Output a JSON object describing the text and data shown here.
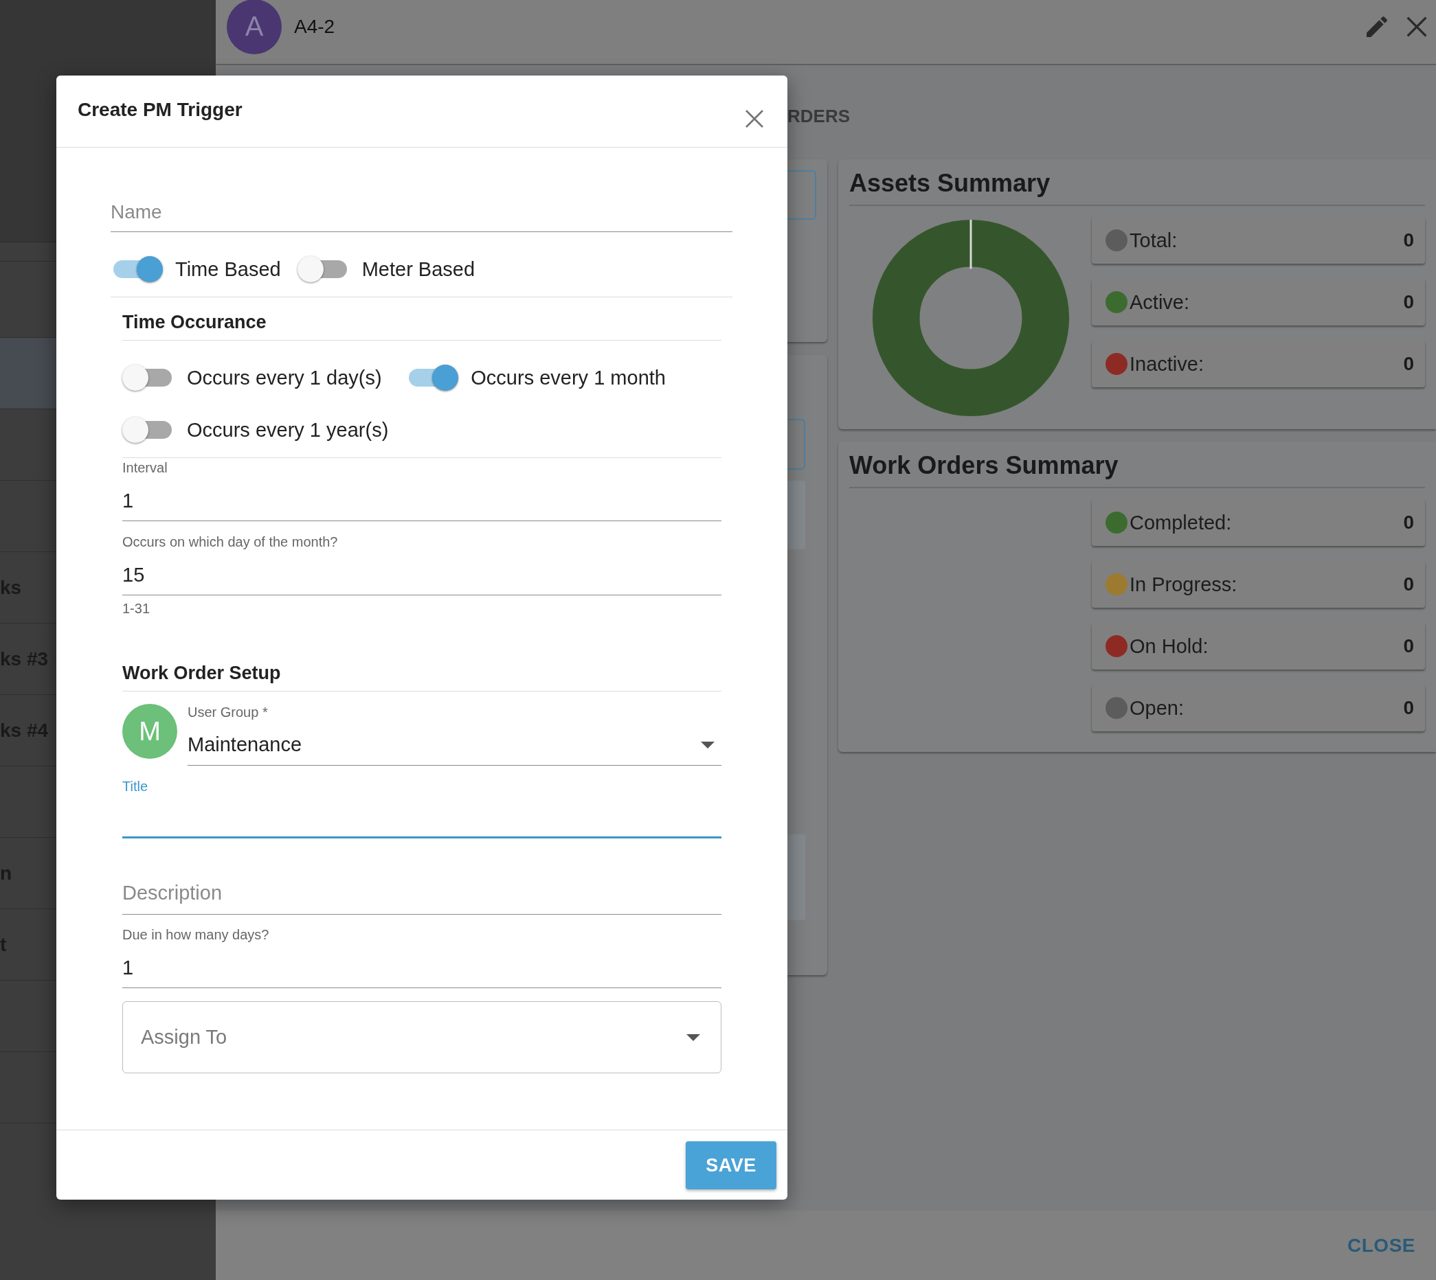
{
  "sidebar": {
    "items": [
      {
        "selected": false
      },
      {
        "selected": true
      },
      {
        "selected": false
      },
      {
        "selected": false
      },
      {
        "label": "ks",
        "selected": false
      },
      {
        "label": "ks #3",
        "selected": false
      },
      {
        "label": "ks #4",
        "selected": false
      },
      {
        "selected": false
      },
      {
        "label": "n",
        "selected": false
      },
      {
        "label": "t",
        "selected": false
      },
      {
        "selected": false
      },
      {
        "selected": false
      },
      {
        "selected": false
      }
    ]
  },
  "record": {
    "avatar": "A",
    "title": "A4-2"
  },
  "tabs": [
    "RDERS"
  ],
  "assets_summary": {
    "title": "Assets Summary",
    "legend": [
      {
        "label": "Total:",
        "value": "0",
        "color": "#5c5c5c"
      },
      {
        "label": "Active:",
        "value": "0",
        "color": "#3c6b30"
      },
      {
        "label": "Inactive:",
        "value": "0",
        "color": "#8e2a24"
      }
    ]
  },
  "work_orders_summary": {
    "title": "Work Orders Summary",
    "legend": [
      {
        "label": "Completed:",
        "value": "0",
        "color": "#3c6b30"
      },
      {
        "label": "In Progress:",
        "value": "0",
        "color": "#9c7a30"
      },
      {
        "label": "On Hold:",
        "value": "0",
        "color": "#8e2a24"
      },
      {
        "label": "Open:",
        "value": "0",
        "color": "#5c5c5c"
      }
    ]
  },
  "footer": {
    "close_button": "CLOSE"
  },
  "dialog": {
    "title": "Create PM Trigger",
    "name_field": {
      "placeholder": "Name"
    },
    "trigger_types": [
      {
        "label": "Time Based",
        "on": true
      },
      {
        "label": "Meter Based",
        "on": false
      }
    ],
    "time_occurrence": {
      "heading": "Time Occurance",
      "options": [
        {
          "label": "Occurs every 1 day(s)",
          "on": false
        },
        {
          "label": "Occurs every 1 month",
          "on": true
        },
        {
          "label": "Occurs every 1 year(s)",
          "on": false
        }
      ]
    },
    "interval": {
      "label": "Interval",
      "value": "1"
    },
    "day_of_month": {
      "label": "Occurs on which day of the month?",
      "value": "15",
      "helper": "1-31"
    },
    "work_order_setup": {
      "heading": "Work Order Setup",
      "user_group": {
        "avatar": "M",
        "label": "User Group *",
        "value": "Maintenance"
      },
      "title_field": {
        "label": "Title",
        "focused": true
      },
      "description": {
        "placeholder": "Description"
      },
      "due_days": {
        "label": "Due in how many days?",
        "value": "1"
      },
      "assign_to": {
        "placeholder": "Assign To"
      }
    },
    "save_button": "SAVE"
  }
}
